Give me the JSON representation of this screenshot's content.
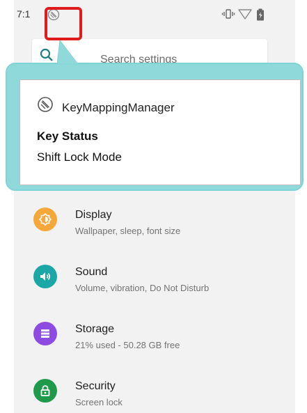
{
  "status_bar": {
    "time": "7:1"
  },
  "search": {
    "placeholder": "Search settings"
  },
  "notification": {
    "app_name": "KeyMappingManager",
    "title": "Key Status",
    "text": "Shift Lock Mode"
  },
  "settings": {
    "items": [
      {
        "title": "Display",
        "subtitle": "Wallpaper, sleep, font size",
        "icon": "display-icon",
        "color": "#f6a73a"
      },
      {
        "title": "Sound",
        "subtitle": "Volume, vibration, Do Not Disturb",
        "icon": "sound-icon",
        "color": "#1ba7a5"
      },
      {
        "title": "Storage",
        "subtitle": "21% used - 50.28 GB free",
        "icon": "storage-icon",
        "color": "#8e4be2"
      },
      {
        "title": "Security",
        "subtitle": "Screen lock",
        "icon": "lock-icon",
        "color": "#1f9a4b"
      }
    ]
  },
  "colors": {
    "highlight": "#e01b1b",
    "callout": "#8fd9db"
  }
}
